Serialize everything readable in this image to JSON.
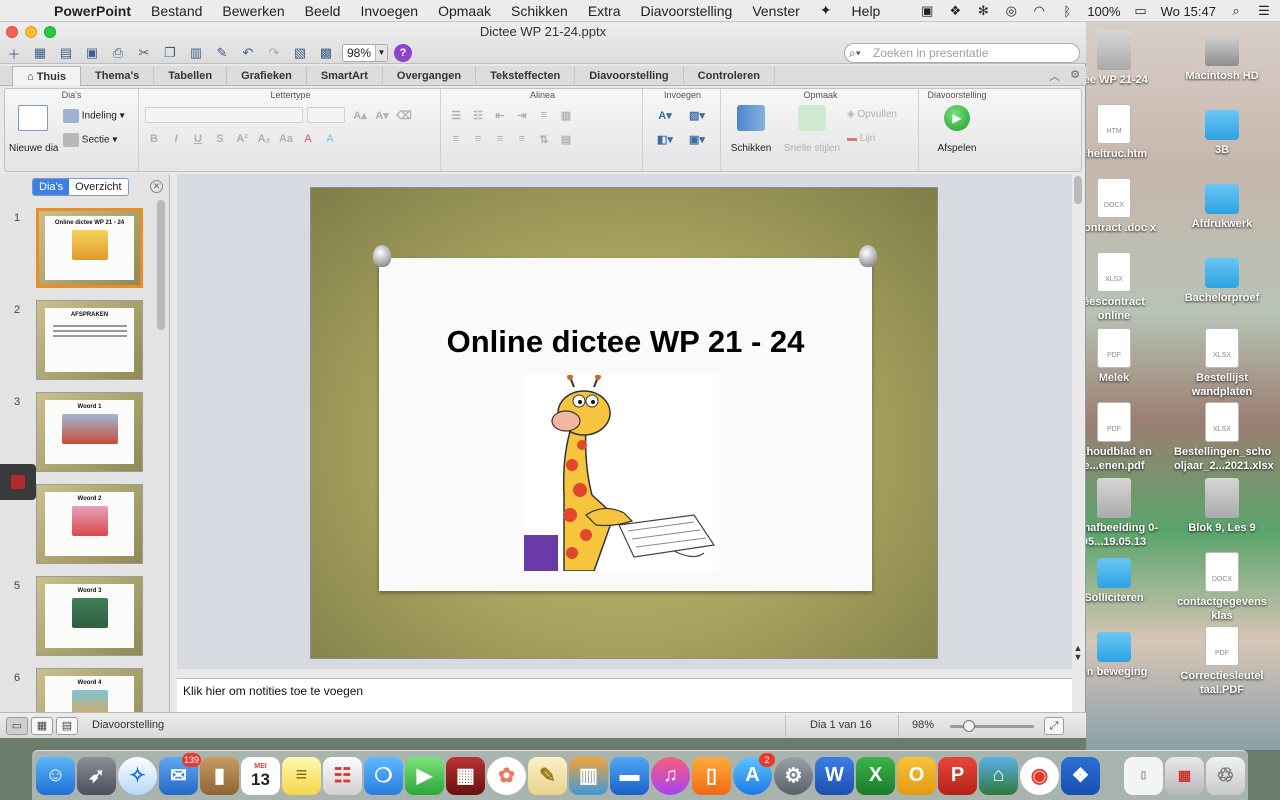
{
  "menubar": {
    "app_name": "PowerPoint",
    "items": [
      "Bestand",
      "Bewerken",
      "Beeld",
      "Invoegen",
      "Opmaak",
      "Schikken",
      "Extra",
      "Diavoorstelling",
      "Venster",
      "Help"
    ],
    "battery": "100%",
    "clock": "Wo 15:47"
  },
  "window": {
    "title": "Dictee WP 21-24.pptx",
    "zoom": "98%",
    "search_placeholder": "Zoeken in presentatie"
  },
  "ribbon": {
    "tabs": [
      "Thuis",
      "Thema's",
      "Tabellen",
      "Grafieken",
      "SmartArt",
      "Overgangen",
      "Teksteffecten",
      "Diavoorstelling",
      "Controleren"
    ],
    "active_tab": "Thuis",
    "groups": {
      "slides": "Dia's",
      "font": "Lettertype",
      "paragraph": "Alinea",
      "insert": "Invoegen",
      "format": "Opmaak",
      "slideshow": "Diavoorstelling"
    },
    "new_slide": "Nieuwe dia",
    "layout": "Indeling",
    "section": "Sectie",
    "arrange": "Schikken",
    "quick_styles": "Snelle stijlen",
    "fill": "Opvullen",
    "line": "Lijn",
    "play": "Afspelen"
  },
  "left_pane": {
    "tab_slides": "Dia's",
    "tab_outline": "Overzicht",
    "thumbnails": [
      {
        "number": "1",
        "title": "Online dictee WP 21 - 24"
      },
      {
        "number": "2",
        "title": "AFSPRAKEN"
      },
      {
        "number": "3",
        "title": "Woord 1"
      },
      {
        "number": "4",
        "title": "Woord 2"
      },
      {
        "number": "5",
        "title": "Woord 3"
      },
      {
        "number": "6",
        "title": "Woord 4"
      }
    ]
  },
  "slide": {
    "title": "Online dictee WP 21 - 24"
  },
  "notes": {
    "placeholder": "Klik hier om notities toe te voegen"
  },
  "statusbar": {
    "view": "Diavoorstelling",
    "slide_counter": "Dia 1 van 16",
    "zoom": "98%"
  },
  "desktop": {
    "icons": [
      {
        "label": "tee WP 21-24",
        "kind": "img"
      },
      {
        "label": "Macintosh HD",
        "kind": "hd"
      },
      {
        "label": "cheltruc.htm",
        "kind": "doc",
        "tag": "HTM"
      },
      {
        "label": "3B",
        "kind": "folder"
      },
      {
        "label": "scontract .doc x",
        "kind": "doc",
        "tag": "DOCX"
      },
      {
        "label": "Afdrukwerk",
        "kind": "folder"
      },
      {
        "label": "éescontract online",
        "kind": "doc",
        "tag": "XLSX"
      },
      {
        "label": "Bachelorproef",
        "kind": "folder"
      },
      {
        "label": "Melek",
        "kind": "doc",
        "tag": "PDF"
      },
      {
        "label": "Bestellijst wandplaten",
        "kind": "doc",
        "tag": "XLSX"
      },
      {
        "label": "nthoudblad en e...enen.pdf",
        "kind": "doc",
        "tag": "PDF"
      },
      {
        "label": "Bestellingen_scho oljaar_2...2021.xlsx",
        "kind": "doc",
        "tag": "XLSX"
      },
      {
        "label": "ermafbeelding 0-05...19.05.13",
        "kind": "img"
      },
      {
        "label": "Blok 9, Les 9",
        "kind": "img"
      },
      {
        "label": "Solliciteren",
        "kind": "folder"
      },
      {
        "label": "contactgegevens klas",
        "kind": "doc",
        "tag": "DOCX"
      },
      {
        "label": "en beweging",
        "kind": "folder"
      },
      {
        "label": "Correctiesleutel taal.PDF",
        "kind": "doc",
        "tag": "PDF"
      }
    ]
  },
  "dock": {
    "mail_badge": "139",
    "calendar_month": "MEI",
    "calendar_day": "13",
    "appstore_badge": "2"
  },
  "colors": {
    "accent": "#3d7fe6",
    "selected_thumb": "#f08a24",
    "slide_background": "#a9a45f"
  }
}
